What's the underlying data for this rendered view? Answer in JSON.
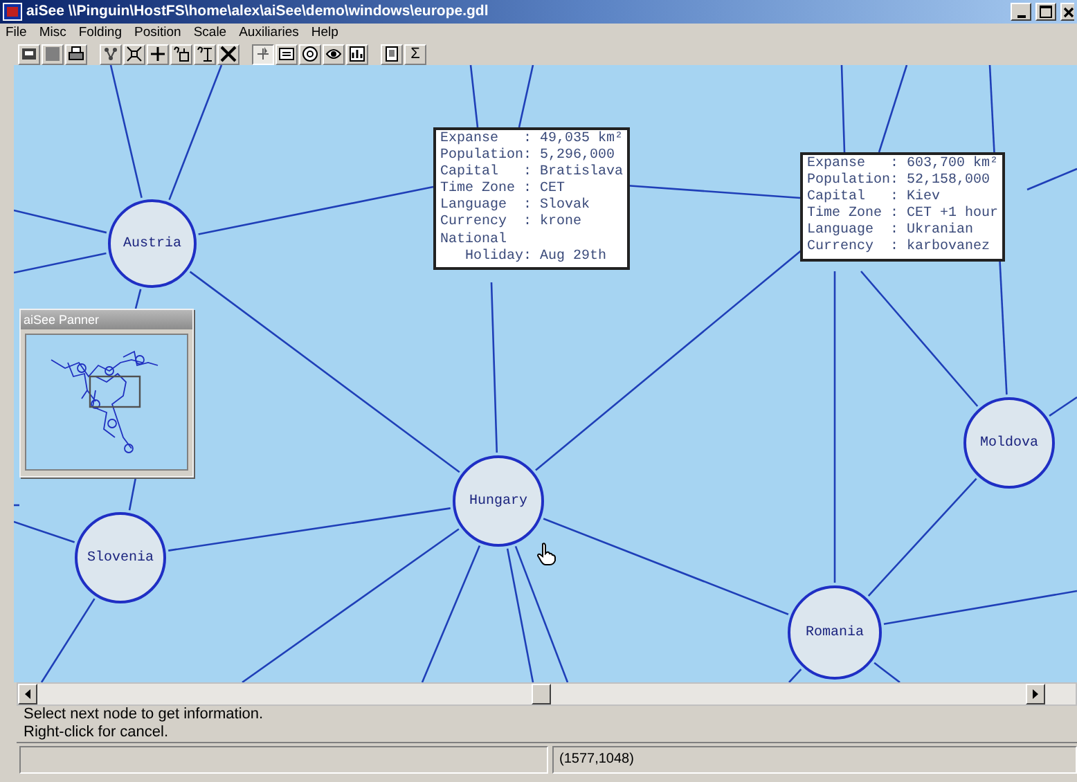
{
  "window": {
    "title": "aiSee \\\\Pinguin\\HostFS\\home\\alex\\aiSee\\demo\\windows\\europe.gdl"
  },
  "menu": [
    "File",
    "Misc",
    "Folding",
    "Position",
    "Scale",
    "Auxiliaries",
    "Help"
  ],
  "toolbar": [
    {
      "buttons": [
        {
          "kind": "window",
          "pressed": false
        },
        {
          "kind": "blank",
          "pressed": false
        },
        {
          "kind": "printer",
          "pressed": false
        }
      ]
    },
    {
      "buttons": [
        {
          "kind": "nodes",
          "pressed": false
        },
        {
          "kind": "expand",
          "pressed": false
        },
        {
          "kind": "crosshair",
          "pressed": false
        },
        {
          "kind": "query-node",
          "pressed": false
        },
        {
          "kind": "query-edge",
          "pressed": false
        },
        {
          "kind": "collapse",
          "pressed": false
        }
      ]
    },
    {
      "buttons": [
        {
          "kind": "pointer",
          "pressed": true
        },
        {
          "kind": "card",
          "pressed": false
        },
        {
          "kind": "circle",
          "pressed": false
        },
        {
          "kind": "eye",
          "pressed": false
        },
        {
          "kind": "chart",
          "pressed": false
        }
      ]
    },
    {
      "buttons": [
        {
          "kind": "page",
          "pressed": false
        },
        {
          "kind": "text",
          "label": "Σ",
          "pressed": false
        }
      ]
    }
  ],
  "graph": {
    "nodes": [
      {
        "label": "Austria"
      },
      {
        "label": "Hungary"
      },
      {
        "label": "Slovenia"
      },
      {
        "label": "Romania"
      },
      {
        "label": "Moldova"
      }
    ],
    "info_boxes": [
      {
        "lines": [
          "Expanse   : 49,035 km²",
          "Population: 5,296,000",
          "Capital   : Bratislava",
          "Time Zone : CET",
          "Language  : Slovak",
          "Currency  : krone",
          "National",
          "   Holiday: Aug 29th"
        ]
      },
      {
        "lines": [
          "Expanse   : 603,700 km²",
          "Population: 52,158,000",
          "Capital   : Kiev",
          "Time Zone : CET +1 hour",
          "Language  : Ukranian",
          "Currency  : karbovanez"
        ]
      }
    ]
  },
  "panner": {
    "title": "aiSee Panner"
  },
  "messages": [
    "Select next node to get information.",
    "Right-click for cancel."
  ],
  "status_bar": {
    "coordinates": "(1577,1048)"
  }
}
